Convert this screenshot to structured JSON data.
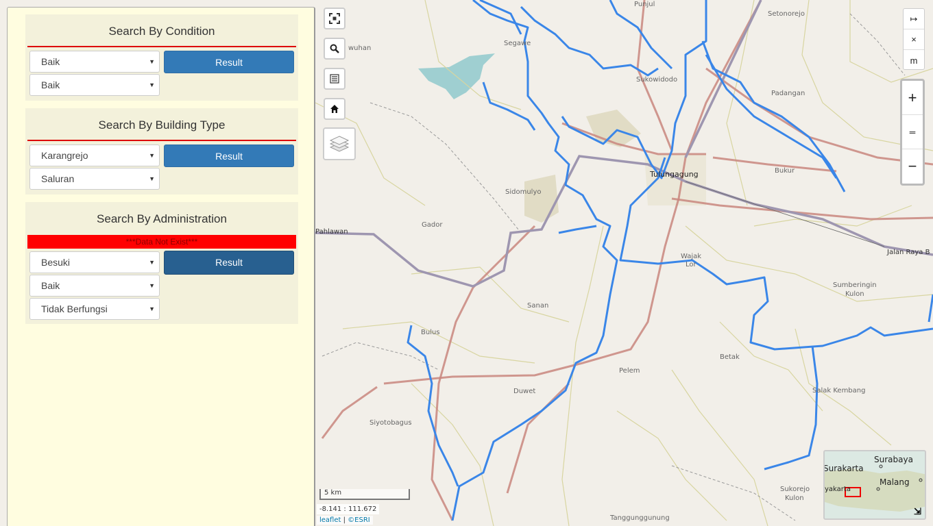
{
  "sidebar": {
    "condition": {
      "title": "Search By Condition",
      "select1": "Baik",
      "select2": "Baik",
      "button": "Result"
    },
    "building": {
      "title": "Search By Building Type",
      "select1": "Karangrejo",
      "select2": "Saluran",
      "button": "Result"
    },
    "administration": {
      "title": "Search By Administration",
      "alert": "***Data Not Exist***",
      "select1": "Besuki",
      "select2": "Baik",
      "select3": "Tidak Berfungsi",
      "button": "Result"
    }
  },
  "map": {
    "places": {
      "tulungagung": "Tulungagung",
      "sukowidodo": "Sukowidodo",
      "segawe": "Segawe",
      "setonorejo": "Setonorejo",
      "padangan": "Padangan",
      "bukur": "Bukur",
      "sidomulyo": "Sidomulyo",
      "gador": "Gador",
      "wajak": "Wajak",
      "lor": "Lor",
      "sumberingin": "Sumberingin",
      "kulon1": "Kulon",
      "sanan": "Sanan",
      "bulus": "Bulus",
      "betak": "Betak",
      "pelem": "Pelem",
      "duwet": "Duwet",
      "salak": "Salak Kembang",
      "siyotobagus": "Siyotobagus",
      "sukorejo": "Sukorejo",
      "kulon2": "Kulon",
      "tanggung": "Tanggunggunung",
      "wuhan": "wuhan",
      "punjul": "Punjul"
    },
    "roads": {
      "pahlawan": "Pahlawan",
      "jalan_raya": "Jalan Raya B"
    },
    "measure": [
      "↦",
      "×",
      "m"
    ],
    "zoom": {
      "in": "+",
      "mid": "═",
      "out": "−"
    },
    "scale": "5 km",
    "coords": "-8.141 : 111.672",
    "attribution": {
      "leaflet": "leaflet",
      "sep": " | ",
      "esri": "©ESRI"
    },
    "minimap": {
      "surabaya": "Surabaya",
      "surakarta": "Surakarta",
      "malang": "Malang",
      "yakarta": "yakarta"
    }
  },
  "colors": {
    "river": "#3a86e8",
    "road_major": "#9e96b0",
    "road_arterial": "#c9867e",
    "accent": "#337ab7",
    "alert": "#ff0000"
  },
  "icons": [
    "fullscreen-icon",
    "search-icon",
    "list-icon",
    "home-icon",
    "layers-icon",
    "collapse-icon"
  ]
}
